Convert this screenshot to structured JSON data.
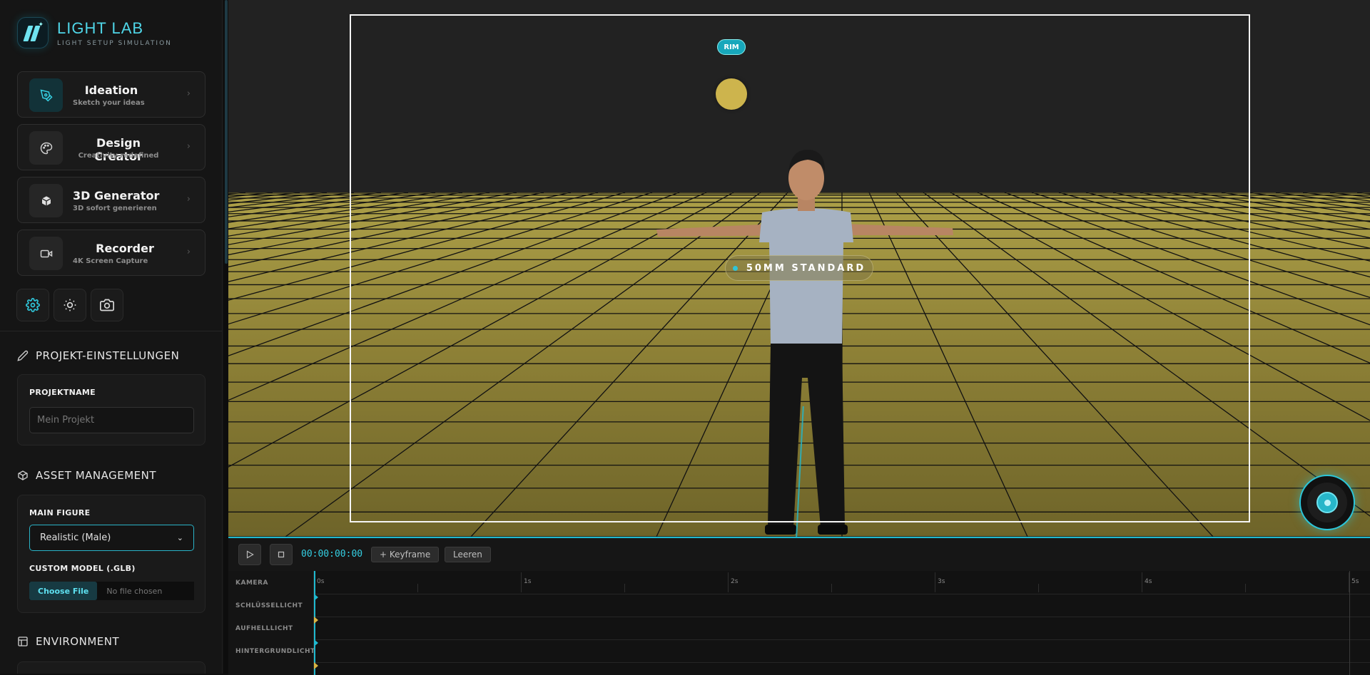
{
  "brand": {
    "title": "LIGHT LAB",
    "subtitle": "LIGHT SETUP SIMULATION"
  },
  "nav": [
    {
      "title": "Ideation",
      "subtitle": "Sketch your ideas",
      "icon": "pen-nib-icon"
    },
    {
      "title": "Design Creator",
      "subtitle": "Creativity redefined",
      "icon": "palette-icon"
    },
    {
      "title": "3D Generator",
      "subtitle": "3D sofort generieren",
      "icon": "cube-icon"
    },
    {
      "title": "Recorder",
      "subtitle": "4K Screen Capture",
      "icon": "video-camera-icon"
    }
  ],
  "tools": [
    "settings-gear-icon",
    "sun-icon",
    "camera-icon"
  ],
  "project": {
    "heading": "PROJEKT-EINSTELLUNGEN",
    "name_label": "PROJEKTNAME",
    "name_placeholder": "Mein Projekt"
  },
  "assets": {
    "heading": "ASSET MANAGEMENT",
    "figure_label": "MAIN FIGURE",
    "figure_value": "Realistic (Male)",
    "custom_label": "CUSTOM MODEL (.GLB)",
    "file_button": "Choose File",
    "file_status": "No file chosen"
  },
  "environment": {
    "heading": "ENVIRONMENT"
  },
  "viewport": {
    "rim_badge": "RIM",
    "lens_label": "50MM STANDARD",
    "accent": "#1fb9cf"
  },
  "timeline": {
    "timecode": "00:00:00:00",
    "add_keyframe": "+ Keyframe",
    "clear": "Leeren",
    "ticks": [
      "0s",
      "1s",
      "2s",
      "3s",
      "4s",
      "5s"
    ],
    "tracks": [
      "KAMERA",
      "SCHLÜSSELLICHT",
      "AUFHELLLICHT",
      "HINTERGRUNDLICHT"
    ]
  }
}
